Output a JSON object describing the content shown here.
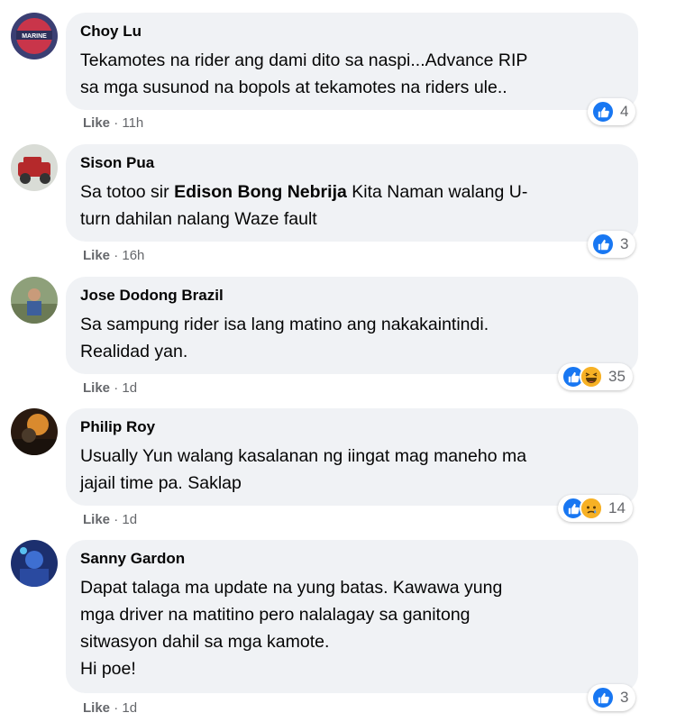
{
  "comments": [
    {
      "author": "Choy Lu",
      "text": "Tekamotes na rider ang dami dito sa naspi...Advance RIP\nsa mga susunod na bopols at tekamotes na riders ule..",
      "like_label": "Like",
      "time": "11h",
      "reaction_count": "4",
      "reactions": [
        "like"
      ]
    },
    {
      "author": "Sison Pua",
      "text_before": "Sa totoo sir ",
      "mention": "Edison Bong Nebrija",
      "text_after": " Kita Naman walang U-\nturn dahilan nalang Waze fault",
      "like_label": "Like",
      "time": "16h",
      "reaction_count": "3",
      "reactions": [
        "like"
      ]
    },
    {
      "author": "Jose Dodong Brazil",
      "text": "Sa sampung rider isa lang matino ang nakakaintindi.\nRealidad yan.",
      "like_label": "Like",
      "time": "1d",
      "reaction_count": "35",
      "reactions": [
        "like",
        "haha"
      ]
    },
    {
      "author": "Philip Roy",
      "text": "Usually Yun walang kasalanan ng iingat mag maneho ma\njajail time pa. Saklap",
      "like_label": "Like",
      "time": "1d",
      "reaction_count": "14",
      "reactions": [
        "like",
        "sad"
      ]
    },
    {
      "author": "Sanny Gardon",
      "text": "Dapat talaga ma update na yung batas. Kawawa yung\nmga driver na matitino pero nalalagay sa ganitong\nsitwasyon dahil sa mga kamote.\nHi poe!",
      "like_label": "Like",
      "time": "1d",
      "reaction_count": "3",
      "reactions": [
        "like"
      ]
    }
  ],
  "separator": "·",
  "colors": {
    "bubble": "#f0f2f5",
    "like_blue": "#1877f2",
    "emoji_yellow": "#f7b125",
    "meta_gray": "#65676b"
  }
}
